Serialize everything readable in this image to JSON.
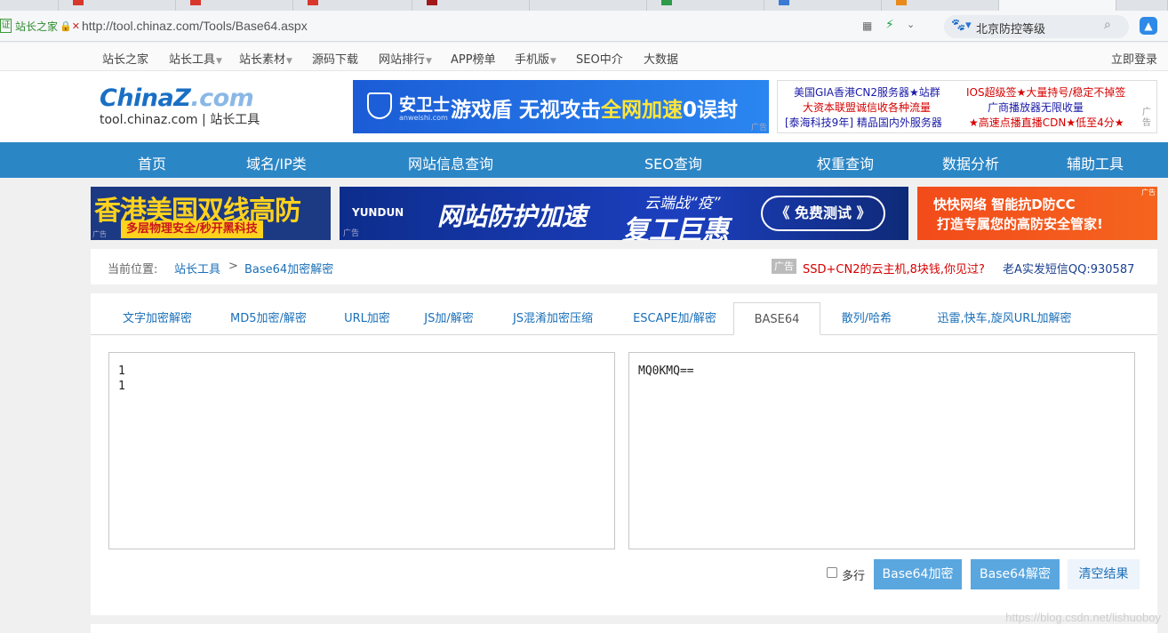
{
  "browser": {
    "cert_label": "站长之家",
    "url": "http://tool.chinaz.com/Tools/Base64.aspx",
    "search_text": "北京防控等级",
    "icons": [
      "shield-cert-icon",
      "lock-warning-icon",
      "qr-code-icon",
      "bolt-icon",
      "chevron-down-icon",
      "baidu-paw-icon",
      "search-icon",
      "extension-icon"
    ]
  },
  "site_topnav": {
    "items": [
      {
        "label": "站长之家",
        "dropdown": false
      },
      {
        "label": "站长工具",
        "dropdown": true
      },
      {
        "label": "站长素材",
        "dropdown": true
      },
      {
        "label": "源码下载",
        "dropdown": false
      },
      {
        "label": "网站排行",
        "dropdown": true
      },
      {
        "label": "APP榜单",
        "dropdown": false
      },
      {
        "label": "手机版",
        "dropdown": true
      },
      {
        "label": "SEO中介",
        "dropdown": false
      },
      {
        "label": "大数据",
        "dropdown": false
      }
    ],
    "login": "立即登录"
  },
  "logo": {
    "brand_a": "China",
    "brand_z": "Z",
    "brand_b": ".com",
    "sub": "tool.chinaz.com | 站长工具"
  },
  "ad_anquan": {
    "name": "安卫士",
    "site": "anweishi.com",
    "slogan_a": "游戏盾 无视攻击",
    "slogan_hl": "全网加速",
    "slogan_b": "0误封",
    "tag": "广告"
  },
  "text_ads": {
    "row1_left": "美国GIA香港CN2服务器★站群",
    "row1_right": "IOS超级签★大量持号/稳定不掉签",
    "row2_left": "大资本联盟诚信收各种流量",
    "row2_right": "广商播放器无限收量",
    "row3_left": "[泰海科技9年] 精品国内外服务器",
    "row3_right": "★高速点播直播CDN★低至4分★",
    "tag": "广告"
  },
  "main_nav": [
    "首页",
    "域名/IP类",
    "网站信息查询",
    "SEO查询",
    "权重查询",
    "数据分析",
    "辅助工具"
  ],
  "banners": {
    "b1_big": "香港美国双线高防",
    "b1_small": "多层物理安全/秒开黑科技",
    "b1_tag": "广告",
    "b2_brand": "YUNDUN",
    "b2_main": "网站防护加速",
    "b2_promo1": "云端战“疫”",
    "b2_promo2": "复工巨惠",
    "b2_cta": "《 免费测试 》",
    "b2_tag": "广告",
    "b3_l1": "快快网络  智能抗D防CC",
    "b3_l2": "打造专属您的高防安全管家!",
    "b3_tag": "广告"
  },
  "breadcrumb": {
    "label": "当前位置:",
    "item1": "站长工具",
    "sep": ">",
    "item2": "Base64加密解密",
    "ad_tag": "广告",
    "ad_link": "SSD+CN2的云主机,8块钱,你见过?",
    "qq": "老A实发短信QQ:930587"
  },
  "tabs": [
    {
      "label": "文字加密解密",
      "active": false
    },
    {
      "label": "MD5加密/解密",
      "active": false
    },
    {
      "label": "URL加密",
      "active": false
    },
    {
      "label": "JS加/解密",
      "active": false
    },
    {
      "label": "JS混淆加密压缩",
      "active": false
    },
    {
      "label": "ESCAPE加/解密",
      "active": false
    },
    {
      "label": "BASE64",
      "active": true
    },
    {
      "label": "散列/哈希",
      "active": false
    },
    {
      "label": "迅雷,快车,旋风URL加解密",
      "active": false
    }
  ],
  "editor": {
    "input_value": "1\n1",
    "output_value": "MQ0KMQ=="
  },
  "controls": {
    "multiline_label": "多行",
    "multiline_checked": false,
    "encode_label": "Base64加密",
    "decode_label": "Base64解密",
    "clear_label": "清空结果"
  },
  "watermark": "https://blog.csdn.net/lishuoboy"
}
